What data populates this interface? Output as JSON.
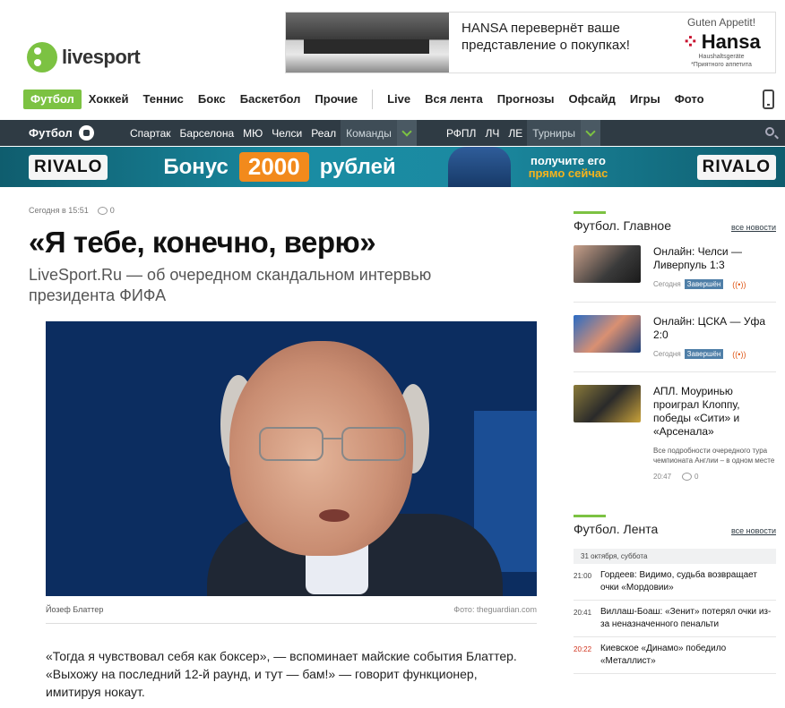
{
  "logo": {
    "text": "livesport"
  },
  "ad_top": {
    "text": "HANSA перевернёт ваше представление о покупках!",
    "slogan": "Guten Appetit!",
    "brand": "Hansa",
    "brand_sub": "Haushaltsgeräte",
    "note": "*Приятного аппетита"
  },
  "main_nav": [
    "Футбол",
    "Хоккей",
    "Теннис",
    "Бокс",
    "Баскетбол",
    "Прочие",
    "Live",
    "Вся лента",
    "Прогнозы",
    "Офсайд",
    "Игры",
    "Фото"
  ],
  "sub_nav": {
    "sport": "Футбол",
    "teams": [
      "Спартак",
      "Барселона",
      "МЮ",
      "Челси",
      "Реал"
    ],
    "teams_dropdown": "Команды",
    "tournaments": [
      "РФПЛ",
      "ЛЧ",
      "ЛЕ"
    ],
    "tournaments_dropdown": "Турниры"
  },
  "banner": {
    "brand_left": "RIVALO",
    "bonus_prefix": "Бонус",
    "bonus_amount": "2000",
    "bonus_suffix": "рублей",
    "cta_line1": "получите его",
    "cta_line2": "прямо сейчас",
    "brand_right": "RIVALO"
  },
  "article": {
    "time": "Сегодня в 15:51",
    "comments": "0",
    "title": "«Я тебе, конечно, верю»",
    "lead": "LiveSport.Ru — об очередном скандальном интервью президента ФИФА",
    "photo_caption": "Йозеф Блаттер",
    "photo_credit": "Фото: theguardian.com",
    "body": "«Тогда я чувствовал себя как боксер», — вспоминает майские события Блаттер. «Выхожу на последний 12-й раунд, и тут — бам!» — говорит функционер, имитируя нокаут."
  },
  "sidebar": {
    "main": {
      "title": "Футбол. Главное",
      "link": "все новости",
      "items": [
        {
          "title": "Онлайн: Челси — Ливерпуль 1:3",
          "date": "Сегодня",
          "status": "Завершён"
        },
        {
          "title": "Онлайн: ЦСКА — Уфа 2:0",
          "date": "Сегодня",
          "status": "Завершён"
        },
        {
          "title": "АПЛ. Моуринью проиграл Клоппу, победы «Сити» и «Арсенала»",
          "desc": "Все подробности очередного тура чемпионата Англии – в одном месте",
          "time": "20:47",
          "comments": "0"
        }
      ]
    },
    "feed": {
      "title": "Футбол. Лента",
      "link": "все новости",
      "date": "31 октября, суббота",
      "items": [
        {
          "time": "21:00",
          "text": "Гордеев: Видимо, судьба возвращает очки «Мордовии»"
        },
        {
          "time": "20:41",
          "text": "Виллаш-Боаш: «Зенит» потерял очки из-за неназначенного пенальти"
        },
        {
          "time": "20:22",
          "text": "Киевское «Динамо» победило «Металлист»"
        }
      ]
    }
  }
}
